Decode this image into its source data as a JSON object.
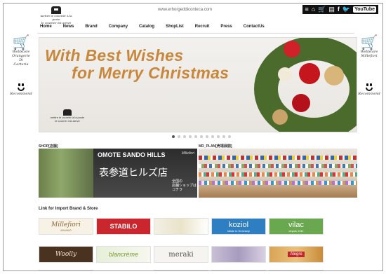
{
  "header": {
    "logo_text": "mettre le courrier à la poste\nle courrier est arrivé",
    "url": "www.erhorgeddiconteca.com",
    "icons": [
      "menu-icon",
      "home-icon",
      "cart-icon",
      "document-icon",
      "facebook-icon",
      "twitter-icon",
      "youtube-icon"
    ],
    "youtube_label": "YouTube"
  },
  "nav": {
    "items": [
      "Home",
      "News",
      "Brand",
      "Company",
      "Catalog",
      "ShopList",
      "Recruit",
      "Press",
      "ContactUs"
    ]
  },
  "side_left": {
    "cart_text": "WebStore\nOrangerie\nDi\nCarteria",
    "smile_text": "Recommend"
  },
  "side_right": {
    "cart_text": "WebStore\nMillefiori",
    "smile_text": "Recommend"
  },
  "banner": {
    "line1": "With Best Wishes",
    "line2": "for Merry Christmas",
    "logo_text": "mettre le courrier à la poste\nle courrier est arrivé",
    "slide_count": 11,
    "active_slide": 1
  },
  "shop": {
    "label": "SHOP[店舗]",
    "title": "OMOTE SANDO HILLS",
    "title_jp": "表参道ヒルズ店",
    "note": "全国の\n店舗ショップは\nコチラ",
    "brand_mark": "Millefiori"
  },
  "mdplan": {
    "label": "MD_PLAN[売場展開]"
  },
  "brands": {
    "label": "Link for Import Brand & Store",
    "row1": [
      "Millefiori",
      "STABILO",
      "",
      "",
      "koziol",
      "vilac"
    ],
    "row1_sub": [
      "MILANO",
      "",
      "",
      "",
      "Made in Germany",
      "depuis 1911"
    ],
    "row2": [
      "Woolly",
      "blancrème",
      "",
      "meraki",
      "",
      "Alegre"
    ]
  },
  "colors": {
    "banner_text": "#c8873a",
    "stabilo_red": "#c9272d",
    "koziol_blue": "#2e7fc2",
    "vilac_green": "#6aa84f"
  }
}
